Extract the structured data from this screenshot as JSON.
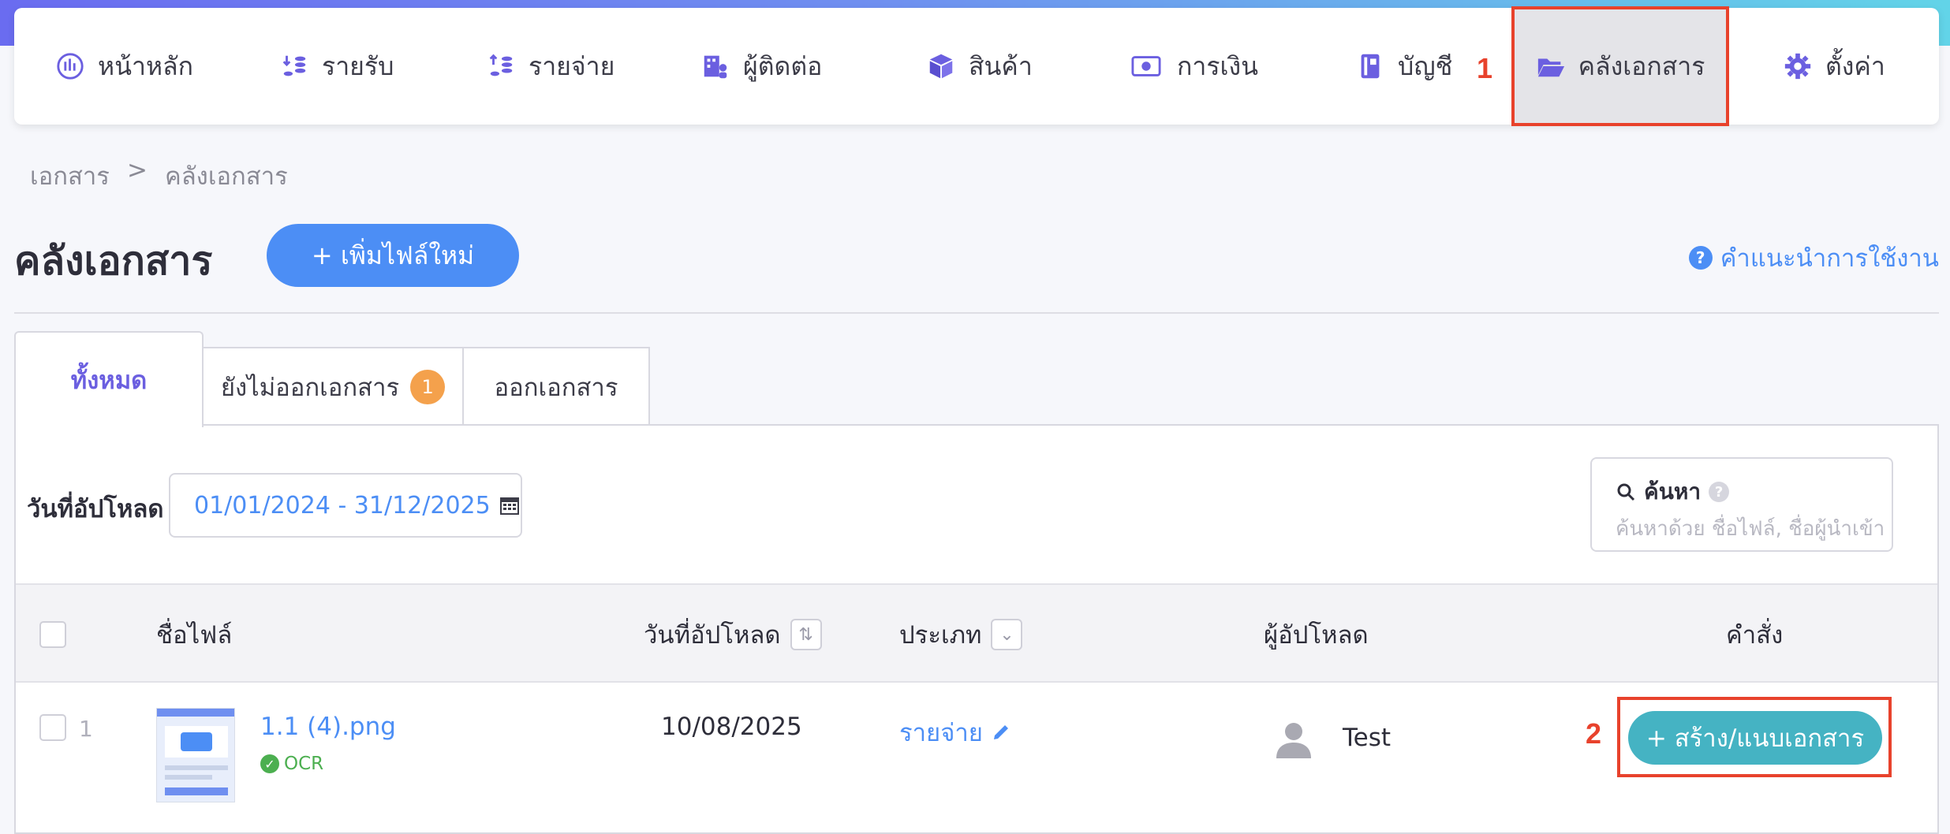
{
  "nav": {
    "items": [
      {
        "label": "หน้าหลัก",
        "icon": "dashboard-icon"
      },
      {
        "label": "รายรับ",
        "icon": "income-icon"
      },
      {
        "label": "รายจ่าย",
        "icon": "expense-icon"
      },
      {
        "label": "ผู้ติดต่อ",
        "icon": "contacts-icon"
      },
      {
        "label": "สินค้า",
        "icon": "product-box-icon"
      },
      {
        "label": "การเงิน",
        "icon": "money-icon"
      },
      {
        "label": "บัญชี",
        "icon": "ledger-icon"
      },
      {
        "label": "คลังเอกสาร",
        "icon": "folder-open-icon"
      },
      {
        "label": "ตั้งค่า",
        "icon": "gear-icon"
      }
    ],
    "active_index": 7
  },
  "markers": {
    "step1": "1",
    "step2": "2"
  },
  "breadcrumb": {
    "root": "เอกสาร",
    "separator": ">",
    "current": "คลังเอกสาร"
  },
  "page": {
    "title": "คลังเอกสาร",
    "add_button": "+ เพิ่มไฟล์ใหม่",
    "help_link": "คำแนะนำการใช้งาน",
    "help_icon_glyph": "?"
  },
  "tabs": [
    {
      "label": "ทั้งหมด"
    },
    {
      "label": "ยังไม่ออกเอกสาร",
      "badge": "1"
    },
    {
      "label": "ออกเอกสาร"
    }
  ],
  "filters": {
    "date_label": "วันที่อัปโหลด",
    "date_range": "01/01/2024 - 31/12/2025",
    "search_label": "ค้นหา",
    "search_help_glyph": "?",
    "search_placeholder": "ค้นหาด้วย ชื่อไฟล์, ชื่อผู้นำเข้า"
  },
  "table": {
    "headers": {
      "filename": "ชื่อไฟล์",
      "upload_date": "วันที่อัปโหลด",
      "type": "ประเภท",
      "uploader": "ผู้อัปโหลด",
      "action": "คำสั่ง"
    },
    "rows": [
      {
        "index": "1",
        "filename": "1.1 (4).png",
        "ocr": "OCR",
        "upload_date": "10/08/2025",
        "type": "รายจ่าย",
        "uploader": "Test",
        "action": "+ สร้าง/แนบเอกสาร"
      }
    ]
  },
  "colors": {
    "accent": "#4c8ef5",
    "highlight": "#e8422c",
    "action_button": "#45b3c3",
    "active_tab_text": "#6b5fe0",
    "badge": "#f4a14c"
  }
}
